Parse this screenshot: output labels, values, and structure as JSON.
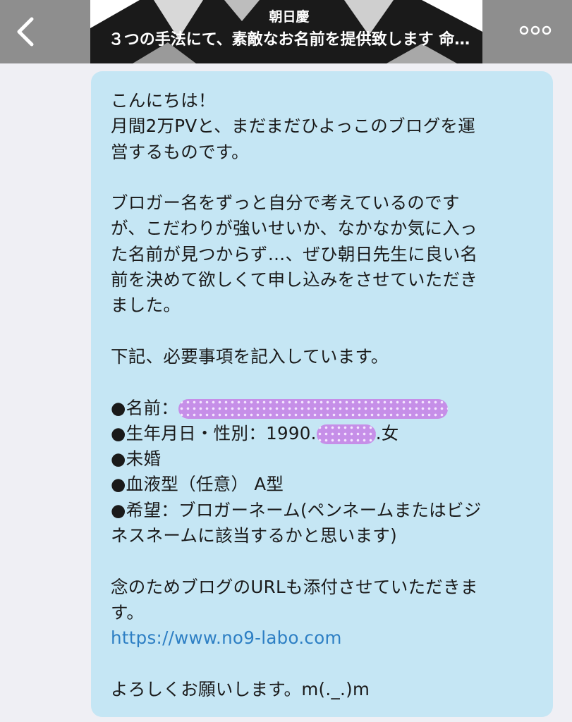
{
  "header": {
    "name": "朝日慶",
    "subtitle": "３つの手法にて、素敵なお名前を提供致します 命…"
  },
  "message": {
    "greeting": "こんにちは！",
    "p1_l1": "月間2万PVと、まだまだひよっこのブログを運",
    "p1_l2": "営するものです。",
    "p2_l1": "ブロガー名をずっと自分で考えているのです",
    "p2_l2": "が、こだわりが強いせいか、なかなか気に入っ",
    "p2_l3": "た名前が見つからず…、ぜひ朝日先生に良い名",
    "p2_l4": "前を決めて欲しくて申し込みをさせていただき",
    "p2_l5": "ました。",
    "p3": "下記、必要事項を記入しています。",
    "name_label": "●名前：",
    "birth_label": "●生年月日・性別：1990.",
    "birth_suffix": ".女",
    "married": "●未婚",
    "blood": "●血液型（任意） A型",
    "wish_l1": "●希望：ブロガーネーム(ペンネームまたはビジ",
    "wish_l2": "ネスネームに該当するかと思います)",
    "url_note_l1": "念のためブログのURLも添付させていただきま",
    "url_note_l2": "す。",
    "url": "https://www.no9-labo.com",
    "closing": "よろしくお願いします。m(._.)m"
  },
  "icons": {
    "back": "chevron-left-icon",
    "more": "more-dots-icon"
  },
  "colors": {
    "bubble": "#c5e6f4",
    "link": "#2d7fc4",
    "redaction": "#c68fe8"
  }
}
